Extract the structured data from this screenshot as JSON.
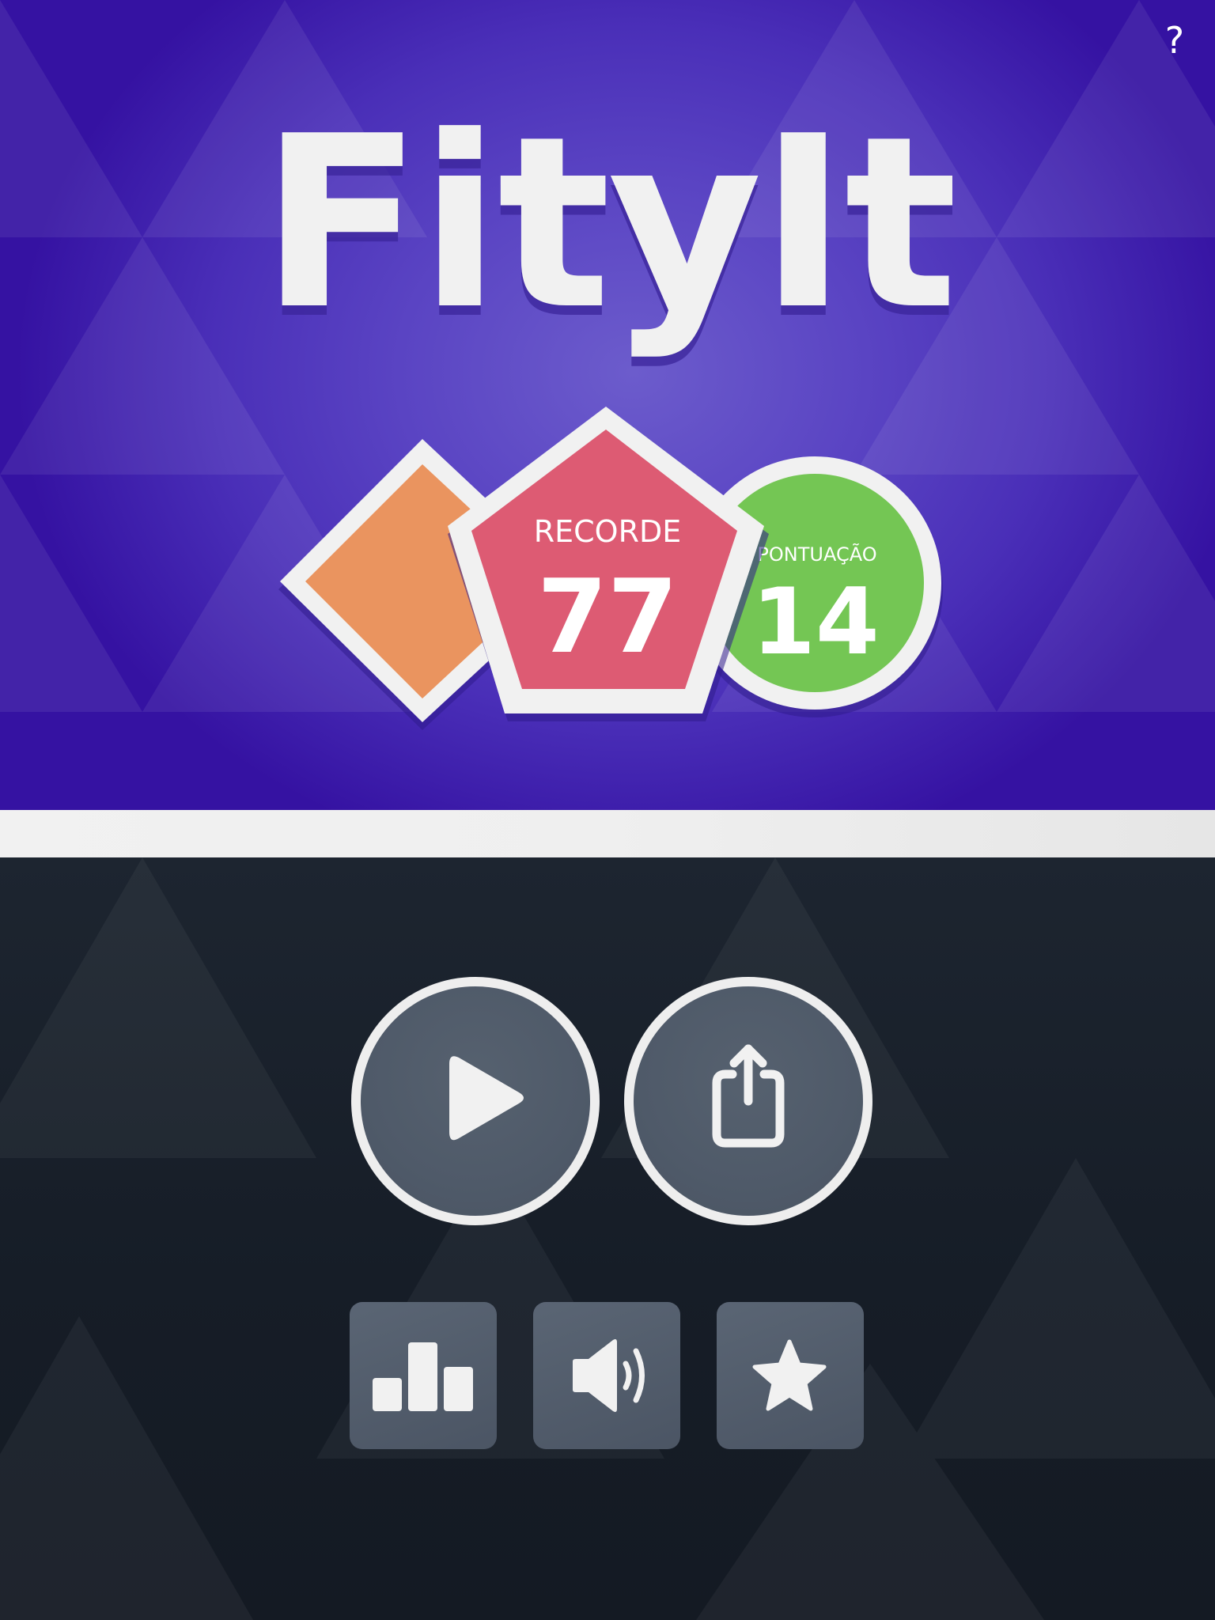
{
  "header": {
    "help_label": "?"
  },
  "logo": {
    "text": "FityIt"
  },
  "scores": {
    "record_label": "RECORDE",
    "record_value": "77",
    "score_label": "PONTUAÇÃO",
    "score_value": "14"
  },
  "controls": {
    "primary": [
      {
        "name": "play",
        "icon": "play-icon"
      },
      {
        "name": "share",
        "icon": "share-icon"
      }
    ],
    "secondary": [
      {
        "name": "leaderboard",
        "icon": "bar-chart-icon"
      },
      {
        "name": "sound",
        "icon": "speaker-icon"
      },
      {
        "name": "rate",
        "icon": "star-icon"
      }
    ]
  },
  "colors": {
    "top_background": "#4a2fb8",
    "bottom_background": "#1a212b",
    "diamond": "#ea945f",
    "pentagon": "#dd5b73",
    "circle": "#74c654",
    "outline": "#f1f1f1",
    "button_fill": "#4f5a69"
  }
}
